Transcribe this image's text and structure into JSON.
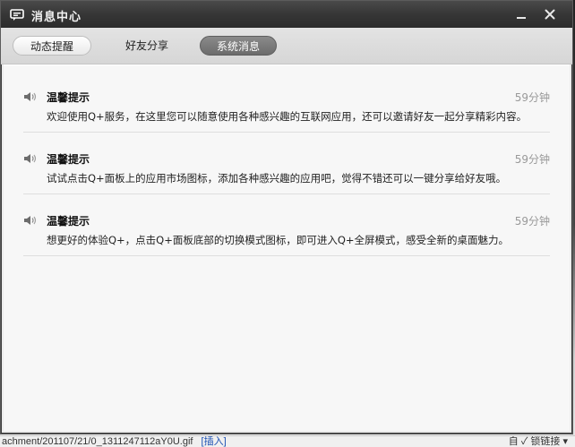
{
  "window": {
    "title": "消息中心",
    "minimize_glyph": "—",
    "close_glyph": "✕"
  },
  "tabs": [
    {
      "label": "动态提醒",
      "state": "normal"
    },
    {
      "label": "好友分享",
      "state": "normal"
    },
    {
      "label": "系统消息",
      "state": "selected"
    }
  ],
  "messages": [
    {
      "icon": "speaker-icon",
      "title": "温馨提示",
      "time": "59分钟",
      "body": "欢迎使用Q+服务，在这里您可以随意使用各种感兴趣的互联网应用，还可以邀请好友一起分享精彩内容。"
    },
    {
      "icon": "speaker-icon",
      "title": "温馨提示",
      "time": "59分钟",
      "body": "试试点击Q+面板上的应用市场图标，添加各种感兴趣的应用吧，觉得不错还可以一键分享给好友哦。"
    },
    {
      "icon": "speaker-icon",
      "title": "温馨提示",
      "time": "59分钟",
      "body": "想更好的体验Q+，点击Q+面板底部的切换模式图标，即可进入Q+全屏模式，感受全新的桌面魅力。"
    }
  ],
  "background_bar": {
    "left_text": "achment/201107/21/0_1311247112aY0U.gif",
    "insert_link": "[插入]",
    "right_text": "自 ✓ 锁链接 ▾"
  },
  "colors": {
    "titlebar": "#363636",
    "selected_tab": "#7a7a7a",
    "content_bg": "#f7f7f7",
    "time_text": "#999999"
  }
}
